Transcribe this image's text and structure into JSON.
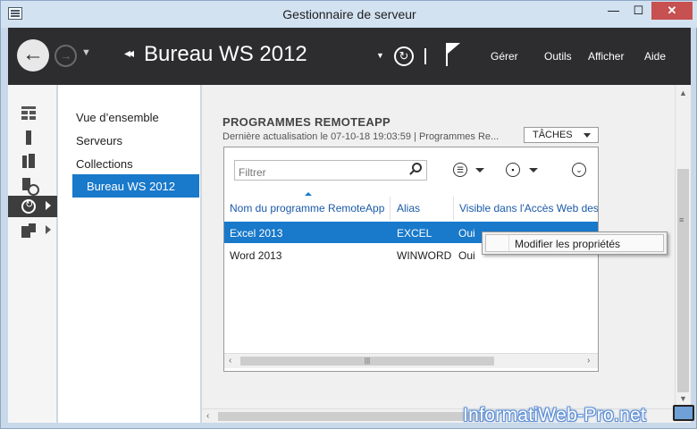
{
  "window": {
    "title": "Gestionnaire de serveur",
    "min_label": "—",
    "max_label": "☐",
    "close_label": "✕"
  },
  "header": {
    "breadcrumb_arrows": "◂◂",
    "breadcrumb": "Bureau WS 2012",
    "menu": {
      "manage": "Gérer",
      "tools": "Outils",
      "view": "Afficher",
      "help": "Aide"
    }
  },
  "iconbar": {
    "items": [
      {
        "icon": "dashboard-icon"
      },
      {
        "icon": "local-server-icon"
      },
      {
        "icon": "all-servers-icon"
      },
      {
        "icon": "file-storage-icon"
      },
      {
        "icon": "remote-desktop-services-icon",
        "active": true
      },
      {
        "icon": "iis-icon"
      }
    ]
  },
  "sidenav": {
    "items": [
      "Vue d’ensemble",
      "Serveurs",
      "Collections",
      "Bureau WS 2012"
    ],
    "selected": "Bureau WS 2012"
  },
  "section": {
    "title": "PROGRAMMES REMOTEAPP",
    "subtitle": "Dernière actualisation le 07-10-18 19:03:59 | Programmes Re...",
    "tasks_label": "TÂCHES"
  },
  "panel": {
    "filter_placeholder": "Filtrer",
    "columns": [
      "Nom du programme RemoteApp",
      "Alias",
      "Visible dans l'Accès Web des"
    ],
    "rows": [
      {
        "name": "Excel 2013",
        "alias": "EXCEL",
        "visible": "Oui",
        "selected": true
      },
      {
        "name": "Word 2013",
        "alias": "WINWORD",
        "visible": "Oui",
        "selected": false
      }
    ]
  },
  "context_menu": {
    "items": [
      "Modifier les propriétés"
    ]
  },
  "watermark": "InformatiWeb-Pro.net",
  "colors": {
    "accent": "#1979ca",
    "header_bg": "#2d2d30",
    "titlebar_bg": "#d3e2f1",
    "close_red": "#c75050"
  }
}
